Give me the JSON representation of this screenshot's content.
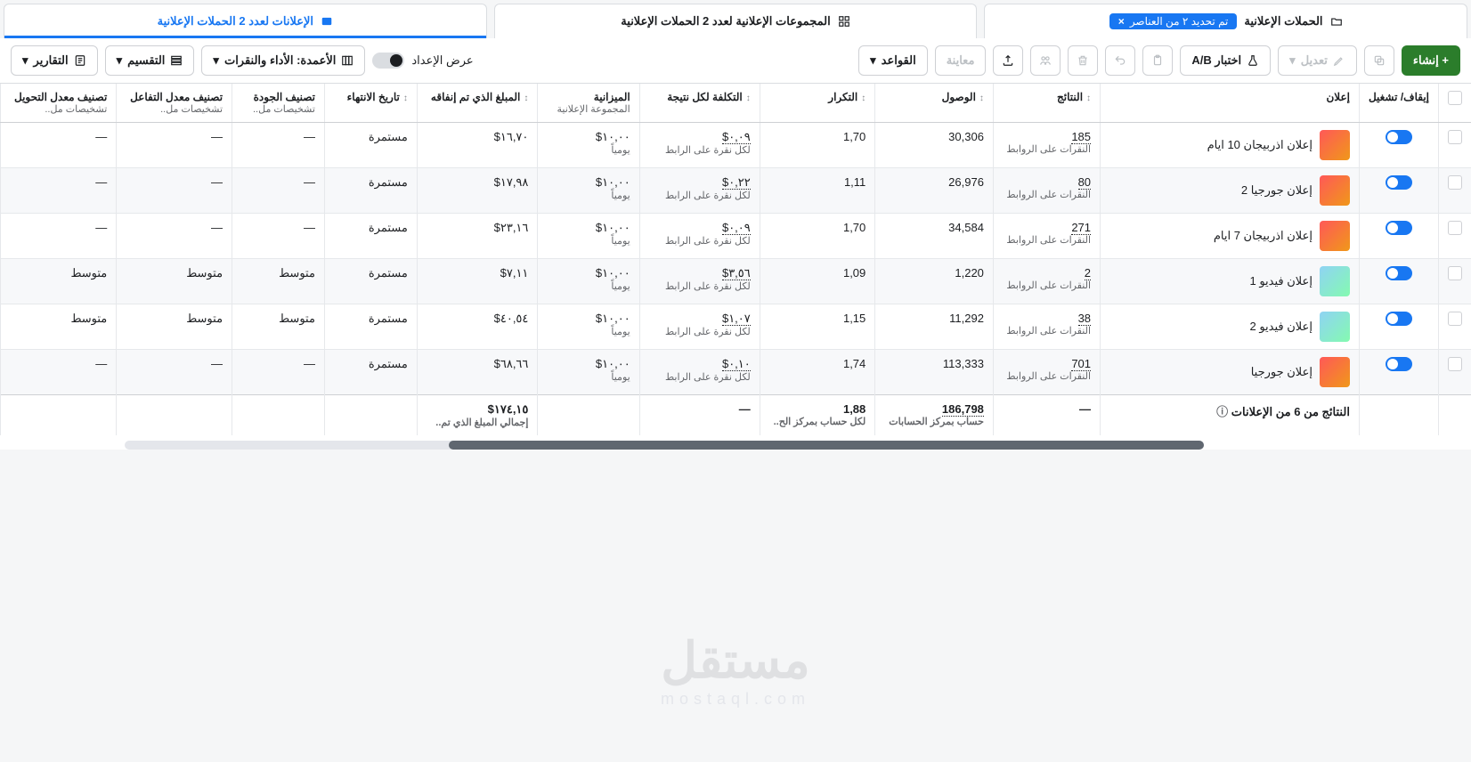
{
  "tabs": {
    "campaigns": {
      "label": "الحملات الإعلانية",
      "filter": "تم تحديد ٢ من العناصر"
    },
    "adsets": {
      "label": "المجموعات الإعلانية لعدد 2 الحملات الإعلانية"
    },
    "ads": {
      "label": "الإعلانات لعدد 2 الحملات الإعلانية"
    }
  },
  "toolbar": {
    "create": "+ إنشاء",
    "edit": "تعديل",
    "ab_test": "اختبار A/B",
    "preview": "معاينة",
    "rules": "القواعد",
    "view_setup": "عرض الإعداد",
    "columns_label": "الأعمدة: الأداء والنقرات",
    "breakdown": "التقسيم",
    "reports": "التقارير"
  },
  "columns": {
    "toggle": "إيقاف/\nتشغيل",
    "ad": "إعلان",
    "results": "النتائج",
    "reach": "الوصول",
    "frequency": "التكرار",
    "cost_per_result": "التكلفة لكل نتيجة",
    "budget": "الميزانية",
    "budget_sub": "المجموعة الإعلانية",
    "amount_spent": "المبلغ الذي تم إنفاقه",
    "end_date": "تاريخ الانتهاء",
    "quality": "تصنيف الجودة",
    "quality_sub": "تشخيصات مل..",
    "engagement": "تصنيف معدل التفاعل",
    "engagement_sub": "تشخيصات مل..",
    "conversion": "تصنيف معدل التحويل",
    "conversion_sub": "تشخيصات مل.."
  },
  "rows": [
    {
      "name": "إعلان اذربيجان 10 ايام",
      "thumb": "g",
      "results": "185",
      "results_sub": "النقرات على الروابط",
      "reach": "30,306",
      "frequency": "1,70",
      "cpr": "٠,٠٩$",
      "cpr_sub": "لكل نقرة على الرابط",
      "budget": "١٠,٠٠$",
      "budget_sub": "يومياً",
      "spent": "١٦,٧٠$",
      "end": "مستمرة",
      "quality": "—",
      "engagement": "—",
      "conversion": "—"
    },
    {
      "name": "إعلان جورجيا 2",
      "thumb": "g",
      "results": "80",
      "results_sub": "النقرات على الروابط",
      "reach": "26,976",
      "frequency": "1,11",
      "cpr": "٠,٢٢$",
      "cpr_sub": "لكل نقرة على الرابط",
      "budget": "١٠,٠٠$",
      "budget_sub": "يومياً",
      "spent": "١٧,٩٨$",
      "end": "مستمرة",
      "quality": "—",
      "engagement": "—",
      "conversion": "—"
    },
    {
      "name": "إعلان اذربيجان 7 ايام",
      "thumb": "g",
      "results": "271",
      "results_sub": "النقرات على الروابط",
      "reach": "34,584",
      "frequency": "1,70",
      "cpr": "٠,٠٩$",
      "cpr_sub": "لكل نقرة على الرابط",
      "budget": "١٠,٠٠$",
      "budget_sub": "يومياً",
      "spent": "٢٣,١٦$",
      "end": "مستمرة",
      "quality": "—",
      "engagement": "—",
      "conversion": "—"
    },
    {
      "name": "إعلان فيديو 1",
      "thumb": "v",
      "results": "2",
      "results_sub": "النقرات على الروابط",
      "reach": "1,220",
      "frequency": "1,09",
      "cpr": "٣,٥٦$",
      "cpr_sub": "لكل نقرة على الرابط",
      "budget": "١٠,٠٠$",
      "budget_sub": "يومياً",
      "spent": "٧,١١$",
      "end": "مستمرة",
      "quality": "متوسط",
      "engagement": "متوسط",
      "conversion": "متوسط"
    },
    {
      "name": "إعلان فيديو 2",
      "thumb": "v",
      "results": "38",
      "results_sub": "النقرات على الروابط",
      "reach": "11,292",
      "frequency": "1,15",
      "cpr": "١,٠٧$",
      "cpr_sub": "لكل نقرة على الرابط",
      "budget": "١٠,٠٠$",
      "budget_sub": "يومياً",
      "spent": "٤٠,٥٤$",
      "end": "مستمرة",
      "quality": "متوسط",
      "engagement": "متوسط",
      "conversion": "متوسط"
    },
    {
      "name": "إعلان جورجيا",
      "thumb": "g",
      "results": "701",
      "results_sub": "النقرات على الروابط",
      "reach": "113,333",
      "frequency": "1,74",
      "cpr": "٠,١٠$",
      "cpr_sub": "لكل نقرة على الرابط",
      "budget": "١٠,٠٠$",
      "budget_sub": "يومياً",
      "spent": "٦٨,٦٦$",
      "end": "مستمرة",
      "quality": "—",
      "engagement": "—",
      "conversion": "—"
    }
  ],
  "footer": {
    "label": "النتائج من 6 من الإعلانات",
    "results": "—",
    "reach": "186,798",
    "reach_sub": "حساب بمركز الحسابات",
    "frequency": "1,88",
    "frequency_sub": "لكل حساب بمركز الح..",
    "cpr": "—",
    "spent": "١٧٤,١٥$",
    "spent_sub": "إجمالي المبلغ الذي تم.."
  },
  "watermark": {
    "big": "مستقل",
    "small": "mostaql.com"
  }
}
